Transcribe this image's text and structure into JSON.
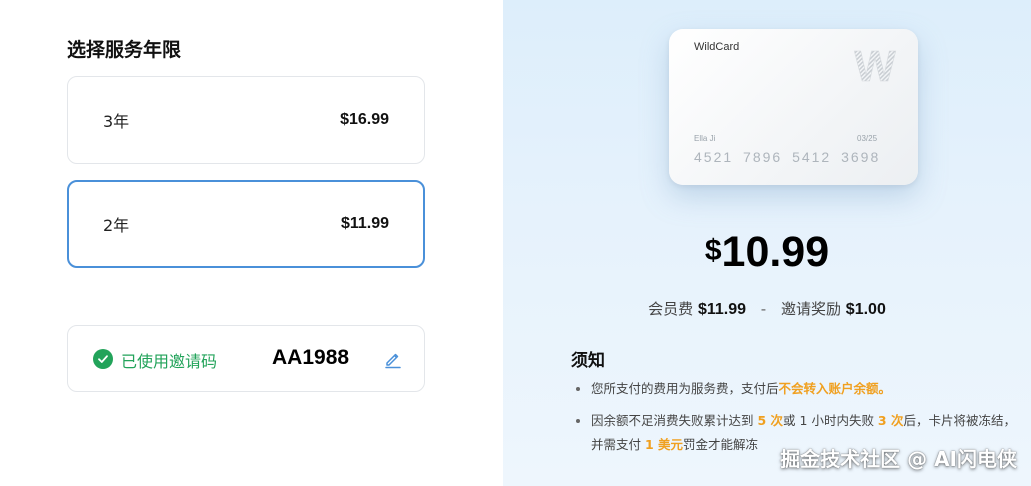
{
  "plans": {
    "title": "选择服务年限",
    "options": [
      {
        "years": "3年",
        "price": "$16.99",
        "selected": false
      },
      {
        "years": "2年",
        "price": "$11.99",
        "selected": true
      }
    ]
  },
  "invite": {
    "status_label": "已使用邀请码",
    "code": "AA1988",
    "status_icon": "check-circle-icon",
    "edit_icon": "pencil-icon"
  },
  "card": {
    "brand": "WildCard",
    "logo": "W",
    "holder": "Ella Ji",
    "expiry": "03/25",
    "number": "4521 7896 5412 3698"
  },
  "summary": {
    "currency": "$",
    "total": "10.99",
    "membership_label": "会员费",
    "membership_amount": "$11.99",
    "separator": "-",
    "reward_label": "邀请奖励",
    "reward_amount": "$1.00"
  },
  "notice": {
    "title": "须知",
    "item1_a": "您所支付的费用为服务费，支付后",
    "item1_b": "不会转入账户余额。",
    "item2_a": "因余额不足消费失败累计达到 ",
    "item2_b": "5 次",
    "item2_c": "或 1 小时内失败 ",
    "item2_d": "3 次",
    "item2_e": "后，卡片将被冻结，并需支付 ",
    "item2_f": "1 美元",
    "item2_g": "罚金才能解冻"
  },
  "watermark": "掘金技术社区 @ AI闪电侠",
  "colors": {
    "accent_blue": "#4a90d9",
    "success_green": "#22a35a",
    "highlight_orange": "#f0a020"
  }
}
